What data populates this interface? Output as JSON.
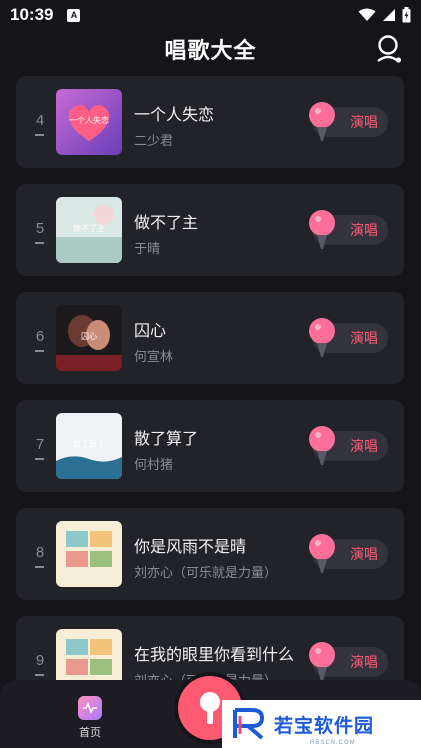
{
  "status_bar": {
    "time": "10:39",
    "notification_letter": "A"
  },
  "header": {
    "title": "唱歌大全",
    "user_icon": "user-icon"
  },
  "songs": [
    {
      "rank": "4",
      "title": "一个人失恋",
      "artist": "二少君",
      "sing_label": "演唱",
      "cover_text": "一个人失恋"
    },
    {
      "rank": "5",
      "title": "做不了主",
      "artist": "于晴",
      "sing_label": "演唱",
      "cover_text": "做不了主"
    },
    {
      "rank": "6",
      "title": "囚心",
      "artist": "何宣林",
      "sing_label": "演唱",
      "cover_text": "囚心"
    },
    {
      "rank": "7",
      "title": "散了算了",
      "artist": "何村猪",
      "sing_label": "演唱",
      "cover_text": "散了算了"
    },
    {
      "rank": "8",
      "title": "你是风雨不是晴",
      "artist": "刘亦心（可乐就是力量）",
      "sing_label": "演唱",
      "cover_text": ""
    },
    {
      "rank": "9",
      "title": "在我的眼里你看到什么",
      "artist": "刘亦心（可乐就是力量）",
      "sing_label": "演唱",
      "cover_text": ""
    }
  ],
  "bottom_nav": {
    "home_label": "首页"
  },
  "watermark": {
    "brand": "若宝软件园",
    "sub": "RBSCN.COM"
  },
  "colors": {
    "background": "#141419",
    "card": "#222229",
    "accent_pink": "#ff5a78",
    "muted_text": "#8a8a93"
  }
}
